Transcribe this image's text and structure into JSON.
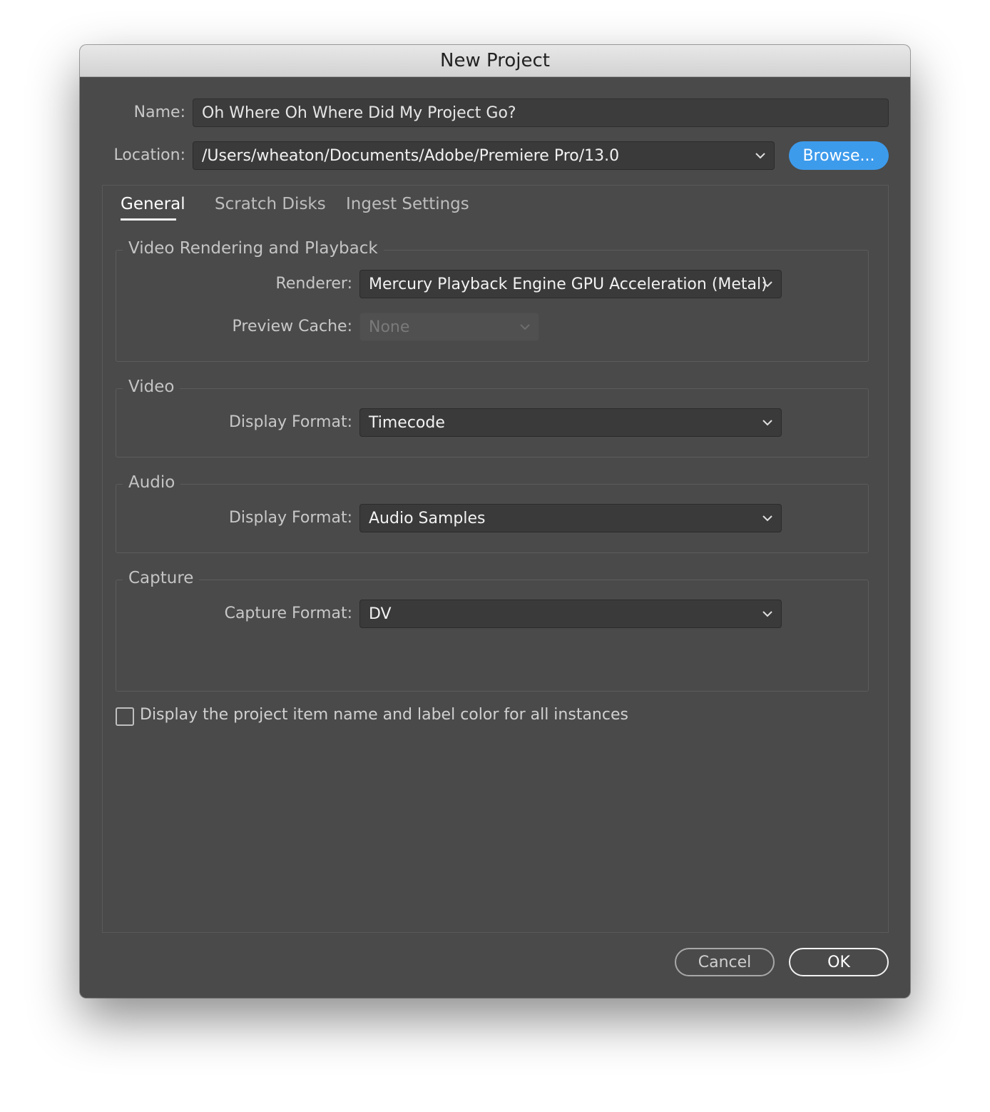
{
  "window": {
    "title": "New Project"
  },
  "name_row": {
    "label": "Name:",
    "value": "Oh  Where Oh Where Did My Project Go?"
  },
  "location_row": {
    "label": "Location:",
    "value": "/Users/wheaton/Documents/Adobe/Premiere Pro/13.0",
    "browse_label": "Browse..."
  },
  "tabs": [
    {
      "label": "General",
      "active": true
    },
    {
      "label": "Scratch Disks",
      "active": false
    },
    {
      "label": "Ingest Settings",
      "active": false
    }
  ],
  "video_rendering": {
    "title": "Video Rendering and Playback",
    "renderer_label": "Renderer:",
    "renderer_value": "Mercury Playback Engine GPU Acceleration (Metal)",
    "preview_cache_label": "Preview Cache:",
    "preview_cache_value": "None"
  },
  "video": {
    "title": "Video",
    "display_format_label": "Display Format:",
    "display_format_value": "Timecode"
  },
  "audio": {
    "title": "Audio",
    "display_format_label": "Display Format:",
    "display_format_value": "Audio Samples"
  },
  "capture": {
    "title": "Capture",
    "capture_format_label": "Capture Format:",
    "capture_format_value": "DV"
  },
  "checkbox": {
    "label": "Display the project item name and label color for all instances",
    "checked": false
  },
  "buttons": {
    "cancel": "Cancel",
    "ok": "OK"
  },
  "colors": {
    "window_bg": "#4a4a4a",
    "browse_accent": "#3d9bec",
    "titlebar": "#dcdcdc"
  },
  "icons": {
    "dropdown": "chevron-down-icon",
    "checkbox": "checkbox-icon"
  }
}
